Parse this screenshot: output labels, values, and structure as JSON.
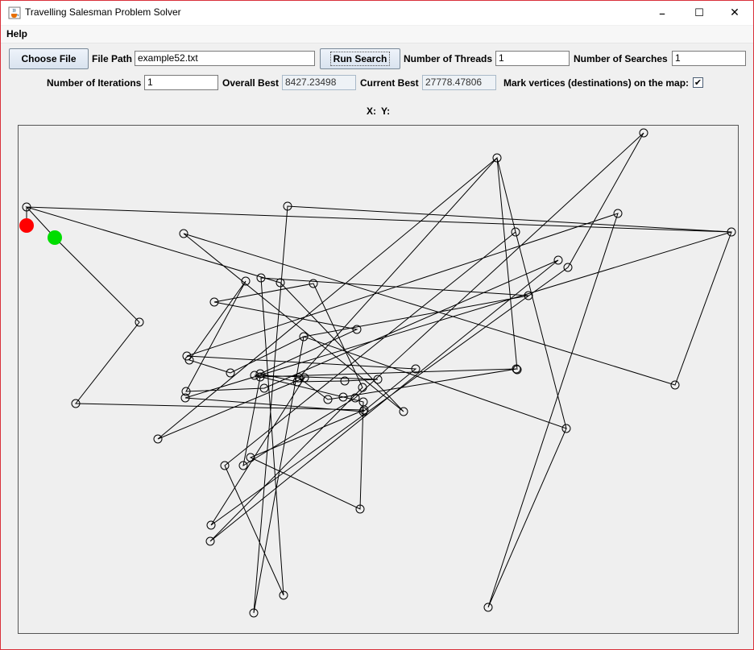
{
  "window": {
    "title": "Travelling Salesman Problem Solver",
    "minimize_glyph": "–",
    "maximize_glyph": "☐",
    "close_glyph": "✕"
  },
  "menu": {
    "help_label": "Help"
  },
  "toolbar": {
    "choose_file_label": "Choose File",
    "file_path_label": "File Path",
    "file_path_value": "example52.txt",
    "run_search_label": "Run Search",
    "threads_label": "Number of Threads",
    "threads_value": "1",
    "searches_label": "Number of Searches",
    "searches_value": "1",
    "iterations_label": "Number of Iterations",
    "iterations_value": "1",
    "overall_best_label": "Overall Best",
    "overall_best_value": "8427.23498",
    "current_best_label": "Current Best",
    "current_best_value": "27778.47806",
    "mark_vertices_label": "Mark vertices (destinations) on the map:",
    "mark_vertices_checked": true,
    "checkmark_glyph": "✔"
  },
  "coords": {
    "x_label": "X:",
    "y_label": "Y:"
  },
  "map": {
    "start_color": "#ff0000",
    "end_color": "#00dd00",
    "start": [
      10,
      124
    ],
    "end": [
      45,
      139
    ],
    "tour": [
      [
        10,
        124
      ],
      [
        10,
        101
      ],
      [
        885,
        132
      ],
      [
        815,
        322
      ],
      [
        205,
        134
      ],
      [
        478,
        355
      ],
      [
        325,
        195
      ],
      [
        10,
        101
      ],
      [
        45,
        139
      ],
      [
        150,
        244
      ],
      [
        71,
        345
      ],
      [
        429,
        353
      ],
      [
        288,
        412
      ],
      [
        424,
        476
      ],
      [
        428,
        343
      ],
      [
        293,
        310
      ],
      [
        446,
        315
      ],
      [
        405,
        317
      ],
      [
        346,
        318
      ],
      [
        300,
        308
      ],
      [
        420,
        253
      ],
      [
        243,
        219
      ],
      [
        366,
        196
      ],
      [
        427,
        325
      ],
      [
        238,
        516
      ],
      [
        670,
        167
      ],
      [
        305,
        326
      ],
      [
        208,
        330
      ],
      [
        282,
        193
      ],
      [
        212,
        291
      ],
      [
        263,
        307
      ],
      [
        354,
        262
      ],
      [
        292,
        605
      ],
      [
        334,
        100
      ],
      [
        885,
        132
      ],
      [
        207,
        338
      ],
      [
        428,
        355
      ],
      [
        493,
        302
      ],
      [
        209,
        286
      ],
      [
        744,
        109
      ],
      [
        583,
        598
      ],
      [
        680,
        376
      ],
      [
        617,
        132
      ],
      [
        680,
        376
      ],
      [
        354,
        262
      ],
      [
        633,
        211
      ],
      [
        301,
        189
      ],
      [
        329,
        583
      ],
      [
        256,
        422
      ],
      [
        617,
        132
      ],
      [
        594,
        40
      ],
      [
        348,
        313
      ],
      [
        384,
        340
      ],
      [
        403,
        337
      ],
      [
        618,
        302
      ],
      [
        300,
        312
      ],
      [
        279,
        422
      ],
      [
        418,
        338
      ],
      [
        776,
        9
      ],
      [
        682,
        176
      ],
      [
        239,
        496
      ],
      [
        355,
        313
      ],
      [
        173,
        389
      ],
      [
        594,
        40
      ],
      [
        619,
        303
      ]
    ]
  }
}
